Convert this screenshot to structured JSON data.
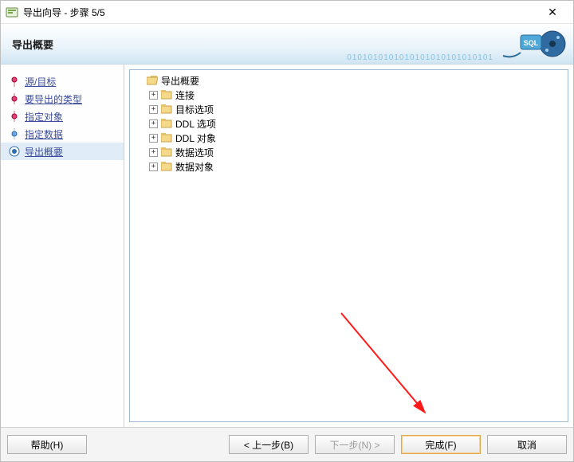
{
  "window": {
    "title": "导出向导 - 步骤 5/5",
    "close_glyph": "✕"
  },
  "header": {
    "summary_title": "导出概要",
    "binary_deco": "0101010101010101010101010101"
  },
  "sidebar": {
    "steps": [
      {
        "label": "源/目标"
      },
      {
        "label": "要导出的类型"
      },
      {
        "label": "指定对象"
      },
      {
        "label": "指定数据"
      },
      {
        "label": "导出概要"
      }
    ],
    "active_index": 4
  },
  "tree": {
    "root_label": "导出概要",
    "children": [
      {
        "label": "连接"
      },
      {
        "label": "目标选项"
      },
      {
        "label": "DDL 选项"
      },
      {
        "label": "DDL 对象"
      },
      {
        "label": "数据选项"
      },
      {
        "label": "数据对象"
      }
    ]
  },
  "buttons": {
    "help": "帮助(H)",
    "back": "< 上一步(B)",
    "next": "下一步(N) >",
    "finish": "完成(F)",
    "cancel": "取消"
  }
}
